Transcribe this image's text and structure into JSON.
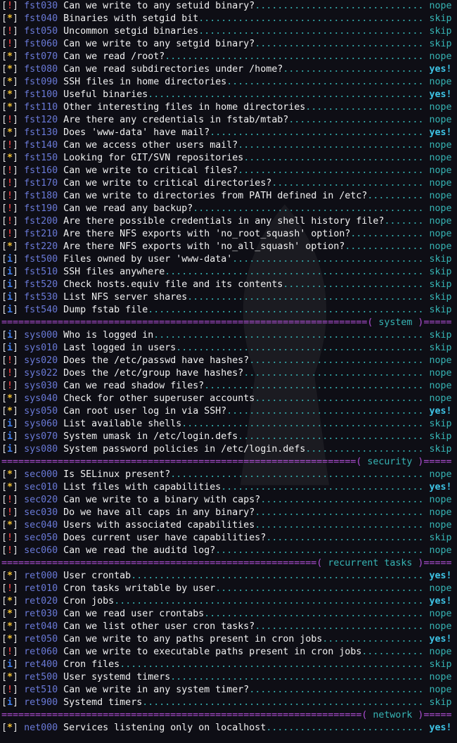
{
  "blocks": [
    {
      "type": "check",
      "tag": "!",
      "code": "fst030",
      "desc": "Can we write to any setuid binary?",
      "result": "nope"
    },
    {
      "type": "check",
      "tag": "*",
      "code": "fst040",
      "desc": "Binaries with setgid bit",
      "result": "skip"
    },
    {
      "type": "check",
      "tag": "!",
      "code": "fst050",
      "desc": "Uncommon setgid binaries",
      "result": "skip"
    },
    {
      "type": "check",
      "tag": "!",
      "code": "fst060",
      "desc": "Can we write to any setgid binary?",
      "result": "skip"
    },
    {
      "type": "check",
      "tag": "*",
      "code": "fst070",
      "desc": "Can we read /root?",
      "result": "nope"
    },
    {
      "type": "check",
      "tag": "*",
      "code": "fst080",
      "desc": "Can we read subdirectories under /home?",
      "result": "yes!"
    },
    {
      "type": "check",
      "tag": "*",
      "code": "fst090",
      "desc": "SSH files in home directories",
      "result": "nope"
    },
    {
      "type": "check",
      "tag": "*",
      "code": "fst100",
      "desc": "Useful binaries",
      "result": "yes!"
    },
    {
      "type": "check",
      "tag": "*",
      "code": "fst110",
      "desc": "Other interesting files in home directories",
      "result": "nope"
    },
    {
      "type": "check",
      "tag": "!",
      "code": "fst120",
      "desc": "Are there any credentials in fstab/mtab?",
      "result": "nope"
    },
    {
      "type": "check",
      "tag": "*",
      "code": "fst130",
      "desc": "Does 'www-data' have mail?",
      "result": "yes!"
    },
    {
      "type": "check",
      "tag": "!",
      "code": "fst140",
      "desc": "Can we access other users mail?",
      "result": "nope"
    },
    {
      "type": "check",
      "tag": "*",
      "code": "fst150",
      "desc": "Looking for GIT/SVN repositories",
      "result": "nope"
    },
    {
      "type": "check",
      "tag": "!",
      "code": "fst160",
      "desc": "Can we write to critical files?",
      "result": "nope"
    },
    {
      "type": "check",
      "tag": "!",
      "code": "fst170",
      "desc": "Can we write to critical directories?",
      "result": "nope"
    },
    {
      "type": "check",
      "tag": "!",
      "code": "fst180",
      "desc": "Can we write to directories from PATH defined in /etc?",
      "result": "nope"
    },
    {
      "type": "check",
      "tag": "!",
      "code": "fst190",
      "desc": "Can we read any backup?",
      "result": "nope"
    },
    {
      "type": "check",
      "tag": "!",
      "code": "fst200",
      "desc": "Are there possible credentials in any shell history file?",
      "result": "nope"
    },
    {
      "type": "check",
      "tag": "!",
      "code": "fst210",
      "desc": "Are there NFS exports with 'no_root_squash' option?",
      "result": "nope"
    },
    {
      "type": "check",
      "tag": "*",
      "code": "fst220",
      "desc": "Are there NFS exports with 'no_all_squash' option?",
      "result": "nope"
    },
    {
      "type": "check",
      "tag": "i",
      "code": "fst500",
      "desc": "Files owned by user 'www-data'",
      "result": "skip"
    },
    {
      "type": "check",
      "tag": "i",
      "code": "fst510",
      "desc": "SSH files anywhere",
      "result": "skip"
    },
    {
      "type": "check",
      "tag": "i",
      "code": "fst520",
      "desc": "Check hosts.equiv file and its contents",
      "result": "skip"
    },
    {
      "type": "check",
      "tag": "i",
      "code": "fst530",
      "desc": "List NFS server shares",
      "result": "skip"
    },
    {
      "type": "check",
      "tag": "i",
      "code": "fst540",
      "desc": "Dump fstab file",
      "result": "skip"
    },
    {
      "type": "section",
      "name": "system"
    },
    {
      "type": "check",
      "tag": "i",
      "code": "sys000",
      "desc": "Who is logged in",
      "result": "skip"
    },
    {
      "type": "check",
      "tag": "i",
      "code": "sys010",
      "desc": "Last logged in users",
      "result": "skip"
    },
    {
      "type": "check",
      "tag": "!",
      "code": "sys020",
      "desc": "Does the /etc/passwd have hashes?",
      "result": "nope"
    },
    {
      "type": "check",
      "tag": "!",
      "code": "sys022",
      "desc": "Does the /etc/group have hashes?",
      "result": "nope"
    },
    {
      "type": "check",
      "tag": "!",
      "code": "sys030",
      "desc": "Can we read shadow files?",
      "result": "nope"
    },
    {
      "type": "check",
      "tag": "*",
      "code": "sys040",
      "desc": "Check for other superuser accounts",
      "result": "nope"
    },
    {
      "type": "check",
      "tag": "*",
      "code": "sys050",
      "desc": "Can root user log in via SSH?",
      "result": "yes!"
    },
    {
      "type": "check",
      "tag": "i",
      "code": "sys060",
      "desc": "List available shells",
      "result": "skip"
    },
    {
      "type": "check",
      "tag": "i",
      "code": "sys070",
      "desc": "System umask in /etc/login.defs",
      "result": "skip"
    },
    {
      "type": "check",
      "tag": "i",
      "code": "sys080",
      "desc": "System password policies in /etc/login.defs",
      "result": "skip"
    },
    {
      "type": "section",
      "name": "security"
    },
    {
      "type": "check",
      "tag": "*",
      "code": "sec000",
      "desc": "Is SELinux present?",
      "result": "nope"
    },
    {
      "type": "check",
      "tag": "*",
      "code": "sec010",
      "desc": "List files with capabilities",
      "result": "yes!"
    },
    {
      "type": "check",
      "tag": "!",
      "code": "sec020",
      "desc": "Can we write to a binary with caps?",
      "result": "nope"
    },
    {
      "type": "check",
      "tag": "!",
      "code": "sec030",
      "desc": "Do we have all caps in any binary?",
      "result": "nope"
    },
    {
      "type": "check",
      "tag": "*",
      "code": "sec040",
      "desc": "Users with associated capabilities",
      "result": "nope"
    },
    {
      "type": "check",
      "tag": "!",
      "code": "sec050",
      "desc": "Does current user have capabilities?",
      "result": "skip"
    },
    {
      "type": "check",
      "tag": "!",
      "code": "sec060",
      "desc": "Can we read the auditd log?",
      "result": "nope"
    },
    {
      "type": "section",
      "name": "recurrent tasks"
    },
    {
      "type": "check",
      "tag": "*",
      "code": "ret000",
      "desc": "User crontab",
      "result": "yes!"
    },
    {
      "type": "check",
      "tag": "!",
      "code": "ret010",
      "desc": "Cron tasks writable by user",
      "result": "nope"
    },
    {
      "type": "check",
      "tag": "*",
      "code": "ret020",
      "desc": "Cron jobs",
      "result": "yes!"
    },
    {
      "type": "check",
      "tag": "*",
      "code": "ret030",
      "desc": "Can we read user crontabs",
      "result": "nope"
    },
    {
      "type": "check",
      "tag": "*",
      "code": "ret040",
      "desc": "Can we list other user cron tasks?",
      "result": "nope"
    },
    {
      "type": "check",
      "tag": "*",
      "code": "ret050",
      "desc": "Can we write to any paths present in cron jobs",
      "result": "yes!"
    },
    {
      "type": "check",
      "tag": "!",
      "code": "ret060",
      "desc": "Can we write to executable paths present in cron jobs",
      "result": "nope"
    },
    {
      "type": "check",
      "tag": "i",
      "code": "ret400",
      "desc": "Cron files",
      "result": "skip"
    },
    {
      "type": "check",
      "tag": "*",
      "code": "ret500",
      "desc": "User systemd timers",
      "result": "nope"
    },
    {
      "type": "check",
      "tag": "!",
      "code": "ret510",
      "desc": "Can we write in any system timer?",
      "result": "nope"
    },
    {
      "type": "check",
      "tag": "i",
      "code": "ret900",
      "desc": "Systemd timers",
      "result": "skip"
    },
    {
      "type": "section",
      "name": "network"
    },
    {
      "type": "check",
      "tag": "*",
      "code": "net000",
      "desc": "Services listening only on localhost",
      "result": "yes!"
    }
  ],
  "colors": {
    "background": "#0e0e15",
    "tag_info": "#3f7ff0",
    "tag_star": "#f5c331",
    "tag_bang": "#e03c3c",
    "code": "#6a7ad8",
    "dots": "#36b4b4",
    "result_yes": "#3ec4e6",
    "section_rule": "#b04fd6"
  }
}
